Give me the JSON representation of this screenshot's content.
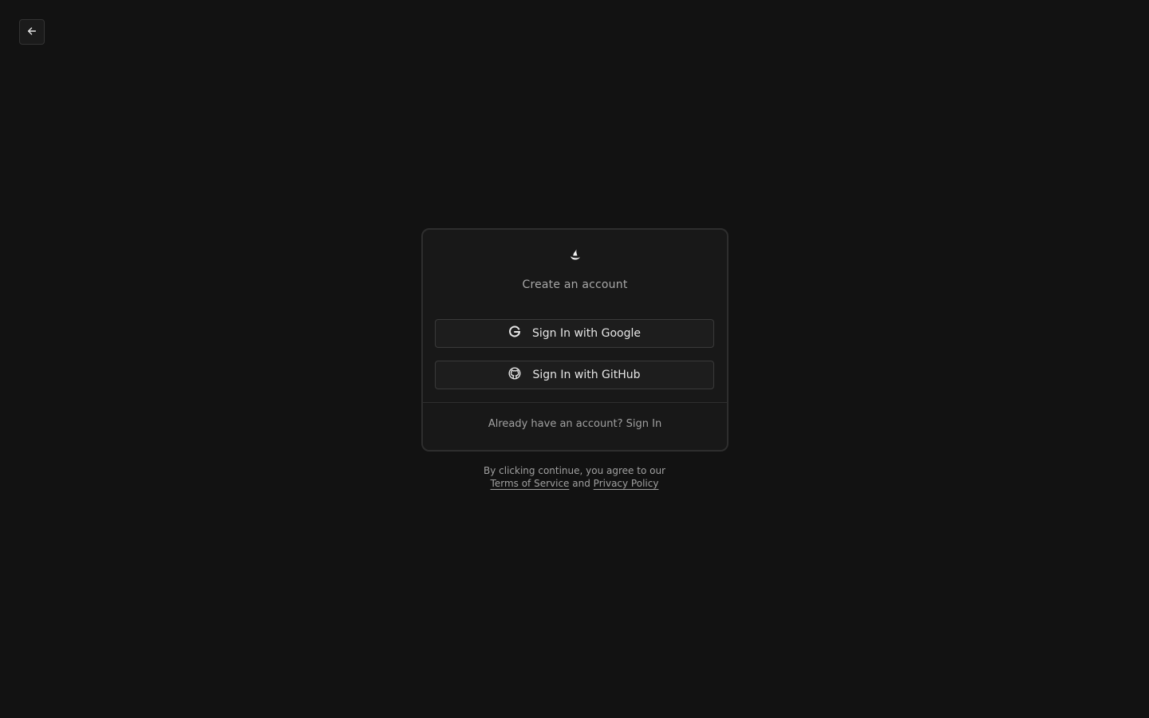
{
  "nav": {
    "back_icon": "arrow-left-icon"
  },
  "card": {
    "logo_icon": "flame-logo-icon",
    "title": "Create an account",
    "google_button_label": "Sign In with Google",
    "google_icon": "google-icon",
    "github_button_label": "Sign In with GitHub",
    "github_icon": "github-icon",
    "footer_prefix": "Already have an account?",
    "footer_link": "Sign In"
  },
  "legal": {
    "line1": "By clicking continue, you agree to our",
    "terms_link": "Terms of Service",
    "and_text": "and",
    "privacy_link": "Privacy Policy"
  },
  "colors": {
    "background": "#121212",
    "card_background": "#181818",
    "border": "#2e2e2e",
    "text_primary": "#e6e6e6",
    "text_muted": "#a0a0a0"
  }
}
